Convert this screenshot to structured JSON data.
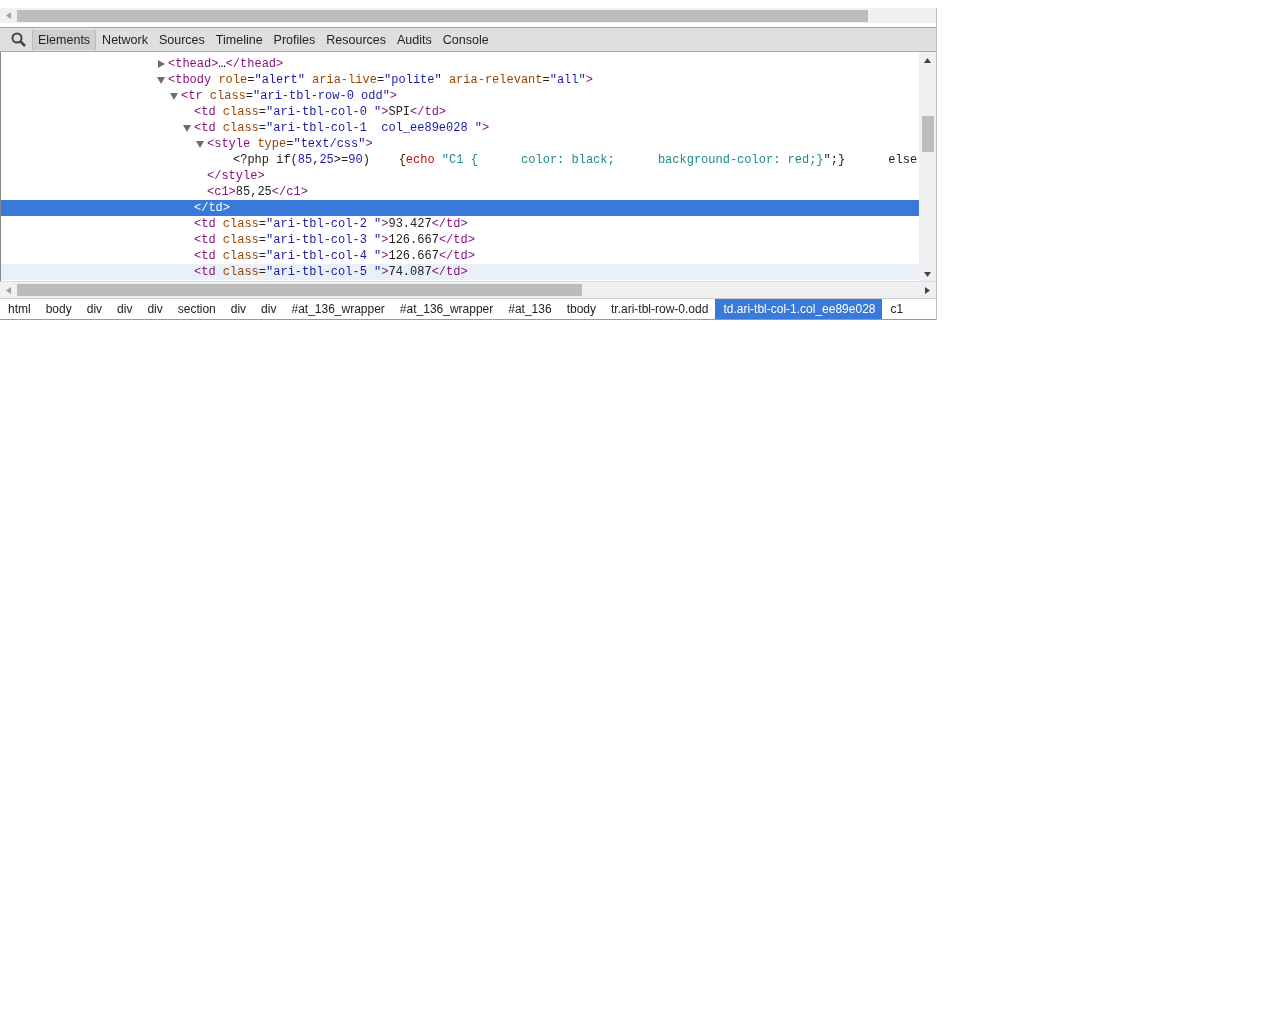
{
  "toolbar": {
    "tabs": [
      {
        "label": "Elements",
        "selected": true
      },
      {
        "label": "Network",
        "selected": false
      },
      {
        "label": "Sources",
        "selected": false
      },
      {
        "label": "Timeline",
        "selected": false
      },
      {
        "label": "Profiles",
        "selected": false
      },
      {
        "label": "Resources",
        "selected": false
      },
      {
        "label": "Audits",
        "selected": false
      },
      {
        "label": "Console",
        "selected": false
      }
    ]
  },
  "dom_tree": [
    {
      "expanded": false,
      "selected": false,
      "hovered": false,
      "open": [
        {
          "kind": "tag",
          "t": "<thead>"
        },
        {
          "kind": "ellipsis",
          "t": "…"
        },
        {
          "kind": "tag",
          "t": "</thead>"
        }
      ]
    },
    {
      "expanded": true,
      "selected": false,
      "hovered": false,
      "open": [
        {
          "kind": "tag",
          "t": "<tbody "
        },
        {
          "kind": "attr",
          "t": "role"
        },
        {
          "kind": "text",
          "t": "="
        },
        {
          "kind": "value",
          "t": "\"alert\""
        },
        {
          "kind": "attr",
          "t": " aria-live"
        },
        {
          "kind": "text",
          "t": "="
        },
        {
          "kind": "value",
          "t": "\"polite\""
        },
        {
          "kind": "attr",
          "t": " aria-relevant"
        },
        {
          "kind": "text",
          "t": "="
        },
        {
          "kind": "value",
          "t": "\"all\""
        },
        {
          "kind": "tag",
          "t": ">"
        }
      ],
      "children": [
        {
          "expanded": true,
          "selected": false,
          "hovered": false,
          "open": [
            {
              "kind": "tag",
              "t": "<tr "
            },
            {
              "kind": "attr",
              "t": "class"
            },
            {
              "kind": "text",
              "t": "="
            },
            {
              "kind": "value",
              "t": "\"ari-tbl-row-0 odd\""
            },
            {
              "kind": "tag",
              "t": ">"
            }
          ],
          "children": [
            {
              "selected": false,
              "hovered": false,
              "open": [
                {
                  "kind": "tag",
                  "t": "<td "
                },
                {
                  "kind": "attr",
                  "t": "class"
                },
                {
                  "kind": "text",
                  "t": "="
                },
                {
                  "kind": "value",
                  "t": "\"ari-tbl-col-0 \""
                },
                {
                  "kind": "tag",
                  "t": ">"
                },
                {
                  "kind": "text",
                  "t": "SPI"
                },
                {
                  "kind": "tag",
                  "t": "</td>"
                }
              ]
            },
            {
              "expanded": true,
              "selected": false,
              "hovered": false,
              "close_selected": true,
              "open": [
                {
                  "kind": "tag",
                  "t": "<td "
                },
                {
                  "kind": "attr",
                  "t": "class"
                },
                {
                  "kind": "text",
                  "t": "="
                },
                {
                  "kind": "value",
                  "t": "\"ari-tbl-col-1  col_ee89e028 \""
                },
                {
                  "kind": "tag",
                  "t": ">"
                }
              ],
              "close": [
                {
                  "kind": "tag",
                  "t": "</td>"
                }
              ],
              "children": [
                {
                  "expanded": true,
                  "selected": false,
                  "hovered": false,
                  "close_selected": false,
                  "open": [
                    {
                      "kind": "tag",
                      "t": "<style "
                    },
                    {
                      "kind": "attr",
                      "t": "type"
                    },
                    {
                      "kind": "text",
                      "t": "="
                    },
                    {
                      "kind": "value",
                      "t": "\"text/css\""
                    },
                    {
                      "kind": "tag",
                      "t": ">"
                    }
                  ],
                  "close": [
                    {
                      "kind": "tag",
                      "t": "</style>"
                    }
                  ],
                  "children": [
                    {
                      "selected": false,
                      "hovered": false,
                      "text_node": true,
                      "open": [
                        {
                          "kind": "text",
                          "t": "<?php if("
                        },
                        {
                          "kind": "value",
                          "t": "85"
                        },
                        {
                          "kind": "text",
                          "t": ","
                        },
                        {
                          "kind": "value",
                          "t": "25"
                        },
                        {
                          "kind": "text",
                          "t": ">="
                        },
                        {
                          "kind": "value",
                          "t": "90"
                        },
                        {
                          "kind": "text",
                          "t": ")    {"
                        },
                        {
                          "kind": "keyword",
                          "t": "echo"
                        },
                        {
                          "kind": "css",
                          "t": " \"C1 {      color: black;      background-color: red;}"
                        },
                        {
                          "kind": "text",
                          "t": "\";}      else"
                        }
                      ]
                    }
                  ]
                },
                {
                  "selected": false,
                  "hovered": false,
                  "open": [
                    {
                      "kind": "tag",
                      "t": "<c1>"
                    },
                    {
                      "kind": "text",
                      "t": "85,25"
                    },
                    {
                      "kind": "tag",
                      "t": "</c1>"
                    }
                  ]
                }
              ]
            },
            {
              "selected": false,
              "hovered": false,
              "open": [
                {
                  "kind": "tag",
                  "t": "<td "
                },
                {
                  "kind": "attr",
                  "t": "class"
                },
                {
                  "kind": "text",
                  "t": "="
                },
                {
                  "kind": "value",
                  "t": "\"ari-tbl-col-2 \""
                },
                {
                  "kind": "tag",
                  "t": ">"
                },
                {
                  "kind": "text",
                  "t": "93.427"
                },
                {
                  "kind": "tag",
                  "t": "</td>"
                }
              ]
            },
            {
              "selected": false,
              "hovered": false,
              "open": [
                {
                  "kind": "tag",
                  "t": "<td "
                },
                {
                  "kind": "attr",
                  "t": "class"
                },
                {
                  "kind": "text",
                  "t": "="
                },
                {
                  "kind": "value",
                  "t": "\"ari-tbl-col-3 \""
                },
                {
                  "kind": "tag",
                  "t": ">"
                },
                {
                  "kind": "text",
                  "t": "126.667"
                },
                {
                  "kind": "tag",
                  "t": "</td>"
                }
              ]
            },
            {
              "selected": false,
              "hovered": false,
              "open": [
                {
                  "kind": "tag",
                  "t": "<td "
                },
                {
                  "kind": "attr",
                  "t": "class"
                },
                {
                  "kind": "text",
                  "t": "="
                },
                {
                  "kind": "value",
                  "t": "\"ari-tbl-col-4 \""
                },
                {
                  "kind": "tag",
                  "t": ">"
                },
                {
                  "kind": "text",
                  "t": "126.667"
                },
                {
                  "kind": "tag",
                  "t": "</td>"
                }
              ]
            },
            {
              "selected": false,
              "hovered": true,
              "open": [
                {
                  "kind": "tag",
                  "t": "<td "
                },
                {
                  "kind": "attr",
                  "t": "class"
                },
                {
                  "kind": "text",
                  "t": "="
                },
                {
                  "kind": "value",
                  "t": "\"ari-tbl-col-5 \""
                },
                {
                  "kind": "tag",
                  "t": ">"
                },
                {
                  "kind": "text",
                  "t": "74.087"
                },
                {
                  "kind": "tag",
                  "t": "</td>"
                }
              ]
            }
          ]
        }
      ]
    }
  ],
  "breadcrumbs": [
    {
      "label": "html",
      "selected": false
    },
    {
      "label": "body",
      "selected": false
    },
    {
      "label": "div",
      "selected": false
    },
    {
      "label": "div",
      "selected": false
    },
    {
      "label": "div",
      "selected": false
    },
    {
      "label": "section",
      "selected": false
    },
    {
      "label": "div",
      "selected": false
    },
    {
      "label": "div",
      "selected": false
    },
    {
      "label": "#at_136_wrapper",
      "selected": false
    },
    {
      "label": "#at_136_wrapper",
      "selected": false
    },
    {
      "label": "#at_136",
      "selected": false
    },
    {
      "label": "tbody",
      "selected": false
    },
    {
      "label": "tr.ari-tbl-row-0.odd",
      "selected": false
    },
    {
      "label": "td.ari-tbl-col-1.col_ee89e028",
      "selected": true
    },
    {
      "label": "c1",
      "selected": false
    }
  ]
}
